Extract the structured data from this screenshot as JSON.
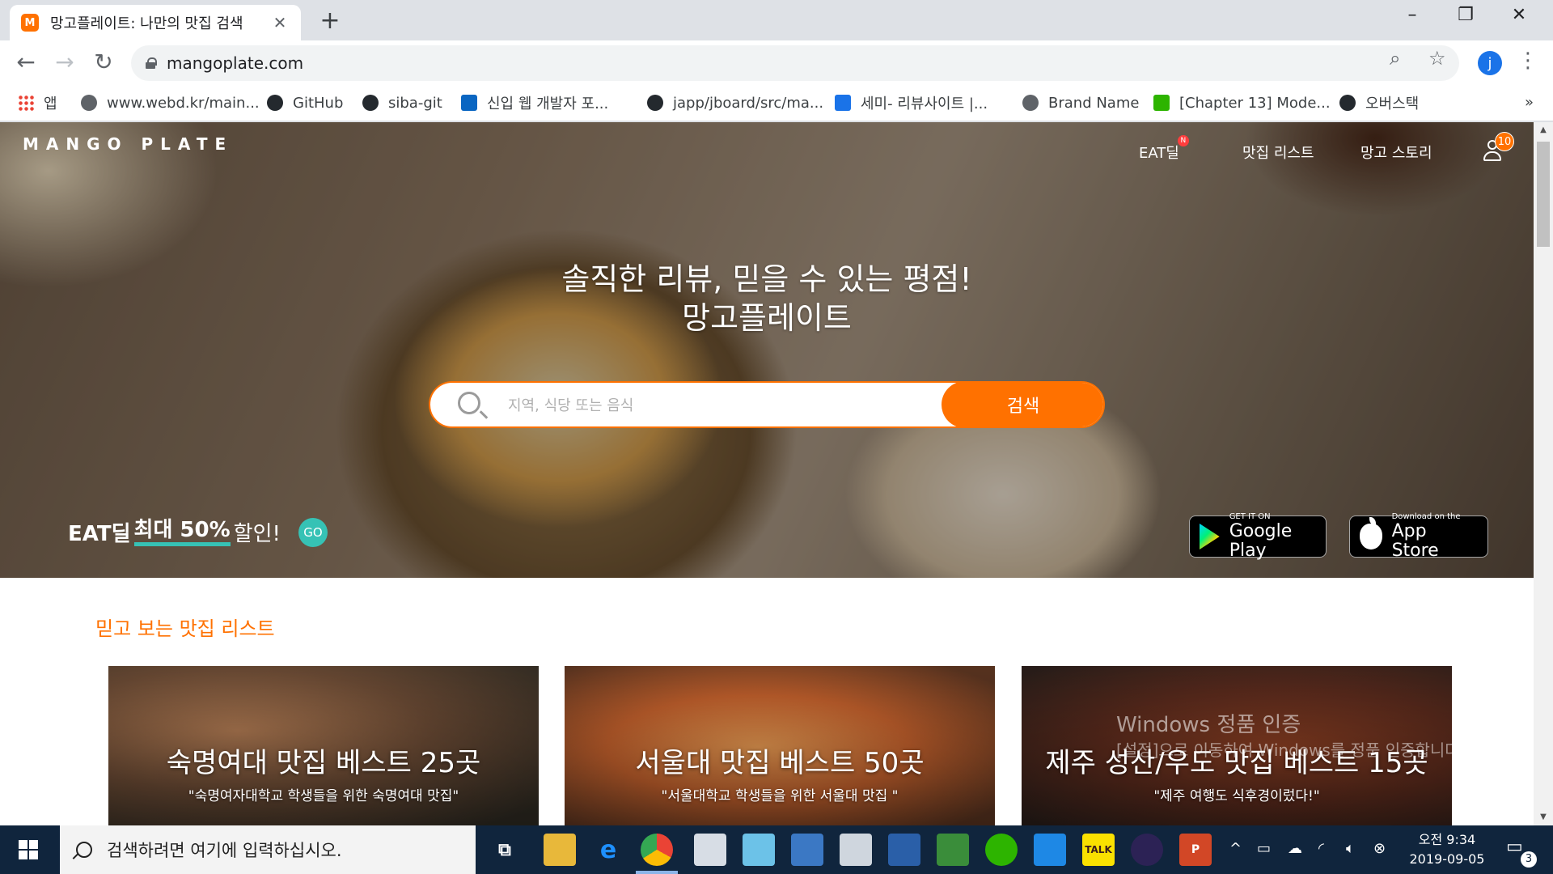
{
  "browser": {
    "tab_title": "망고플레이트: 나만의 맛집 검색",
    "tab_favicon": "M",
    "close_tab": "✕",
    "new_tab": "+",
    "url": "mangoplate.com",
    "profile_initial": "j",
    "bookmarks": [
      {
        "label": "앱",
        "icon": "apps-icon"
      },
      {
        "label": "www.webd.kr/main...",
        "icon": "globe-icon"
      },
      {
        "label": "GitHub",
        "icon": "github-icon"
      },
      {
        "label": "siba-git",
        "icon": "github-icon"
      },
      {
        "label": "신입 웹 개발자 포...",
        "icon": "linkedin-icon"
      },
      {
        "label": "japp/jboard/src/ma...",
        "icon": "github-icon"
      },
      {
        "label": "세미- 리뷰사이트 |...",
        "icon": "trello-icon"
      },
      {
        "label": "Brand Name",
        "icon": "globe-icon"
      },
      {
        "label": "[Chapter 13] Mode...",
        "icon": "blog-icon"
      },
      {
        "label": "오버스택",
        "icon": "github-icon"
      }
    ],
    "bookmarks_more": "»"
  },
  "site": {
    "logo": "MANGO PLATE",
    "nav": {
      "eat_deal": "EAT딜",
      "eat_deal_badge": "N",
      "matzip_list": "맛집 리스트",
      "mango_story": "망고 스토리",
      "user_badge": "10"
    },
    "hero": {
      "tagline_line1": "솔직한 리뷰, 믿을 수 있는 평점!",
      "tagline_line2": "망고플레이트",
      "search_placeholder": "지역, 식당 또는 음식",
      "search_button": "검색",
      "promo_prefix": "EAT딜 ",
      "promo_highlight": "최대 50%",
      "promo_suffix": " 할인!",
      "go_button": "GO",
      "google_play_small": "GET IT ON",
      "google_play_big": "Google Play",
      "app_store_small": "Download on the",
      "app_store_big": "App Store"
    },
    "section_title": "믿고 보는 맛집 리스트",
    "cards": [
      {
        "title": "숙명여대 맛집 베스트 25곳",
        "subtitle": "\"숙명여자대학교 학생들을 위한 숙명여대 맛집\""
      },
      {
        "title": "서울대 맛집 베스트 50곳",
        "subtitle": "\"서울대학교 학생들을 위한 서울대 맛집 \""
      },
      {
        "title": "제주 성산/우도 맛집 베스트 15곳",
        "subtitle": "\"제주 여행도 식후경이렀다!\""
      }
    ],
    "watermark_line1": "Windows 정품 인증",
    "watermark_line2": "[설정]으로 이동하여 Windows를 정품 인증합니다."
  },
  "taskbar": {
    "search_placeholder": "검색하려면 여기에 입력하십시오.",
    "clock_ampm_time": "오전 9:34",
    "clock_date": "2019-09-05",
    "notification_count": "3",
    "accent": "#10253d"
  },
  "colors": {
    "brand_orange": "#ff7100",
    "teal": "#36c2b5"
  }
}
